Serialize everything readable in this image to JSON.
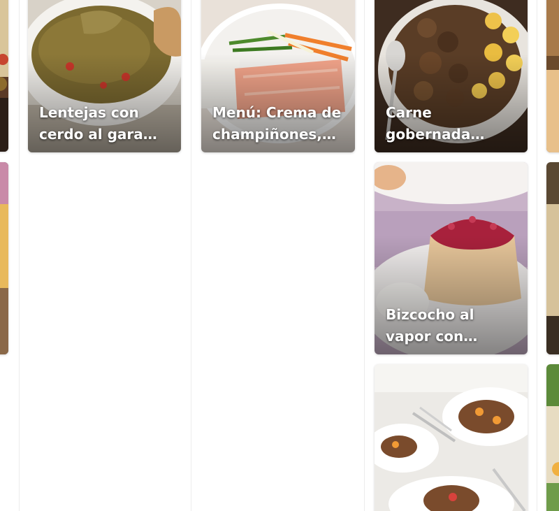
{
  "cards": [
    {
      "title": "Lentejas con cerdo al garam masala"
    },
    {
      "title": "Menú: Crema de champiñones, salmón y verduras"
    },
    {
      "title": "Carne gobernada (Cocción lenta)"
    },
    {
      "title": "Bizcocho al vapor con mermelada de frutos rojos"
    },
    {
      "title": ""
    }
  ]
}
